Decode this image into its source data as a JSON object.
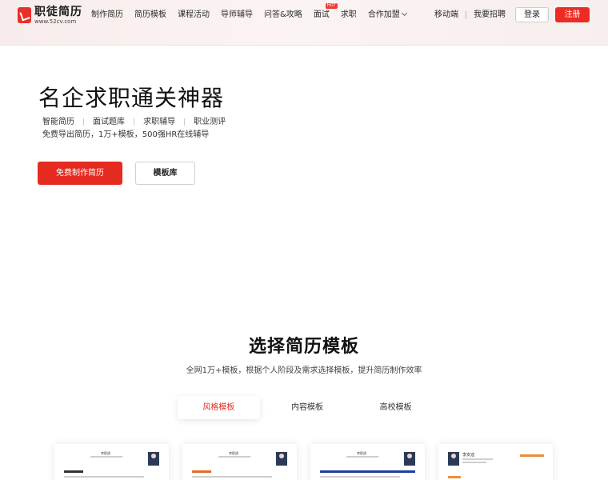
{
  "header": {
    "logo": {
      "name": "职徒简历",
      "url": "www.52cv.com"
    },
    "nav": [
      {
        "label": "制作简历"
      },
      {
        "label": "简历模板"
      },
      {
        "label": "课程活动"
      },
      {
        "label": "导师辅导"
      },
      {
        "label": "问答&攻略"
      },
      {
        "label": "面试",
        "badge": "HOT"
      },
      {
        "label": "求职"
      },
      {
        "label": "合作加盟"
      }
    ],
    "mobile": "移动端",
    "recruit": "我要招聘",
    "login": "登录",
    "register": "注册"
  },
  "hero": {
    "title": "名企求职通关神器",
    "tags": [
      "智能简历",
      "面试题库",
      "求职辅导",
      "职业测评"
    ],
    "tag_separator": "|",
    "subtitle": "免费导出简历，1万+模板，500强HR在线辅导",
    "primary_button": "免费制作简历",
    "secondary_button": "模板库"
  },
  "templates": {
    "title": "选择简历模板",
    "subtitle": "全网1万+模板，根据个人阶段及需求选择模板，提升简历制作效率",
    "tabs": [
      "风格模板",
      "内容模板",
      "高校模板"
    ],
    "active_tab": "风格模板",
    "cards": [
      {
        "name": "李职途",
        "accent": "#333333"
      },
      {
        "name": "李职途",
        "accent": "#e06b2a"
      },
      {
        "name": "李职途",
        "accent": "#1d3f9a"
      },
      {
        "name": "李安迪",
        "accent": "#e9903a"
      }
    ]
  },
  "colors": {
    "brand": "#e52a20",
    "header_bg": "#f7eceb"
  }
}
